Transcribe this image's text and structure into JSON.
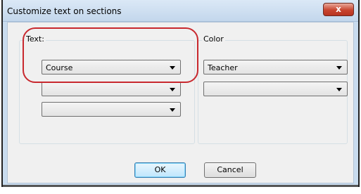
{
  "window": {
    "title": "Customize text on sections",
    "close_label": "x"
  },
  "groups": {
    "text_label": "Text:",
    "color_label": "Color"
  },
  "text_dropdowns": [
    {
      "value": ""
    },
    {
      "value": ""
    },
    {
      "value": ""
    }
  ],
  "text_dropdown_first": "Course",
  "color_dropdowns": [
    {
      "value": "Teacher"
    },
    {
      "value": ""
    }
  ],
  "buttons": {
    "ok": "OK",
    "cancel": "Cancel"
  },
  "colors": {
    "highlight": "#c8282e",
    "close_button": "#c8442f",
    "dialog_bg": "#f0f0f0"
  }
}
